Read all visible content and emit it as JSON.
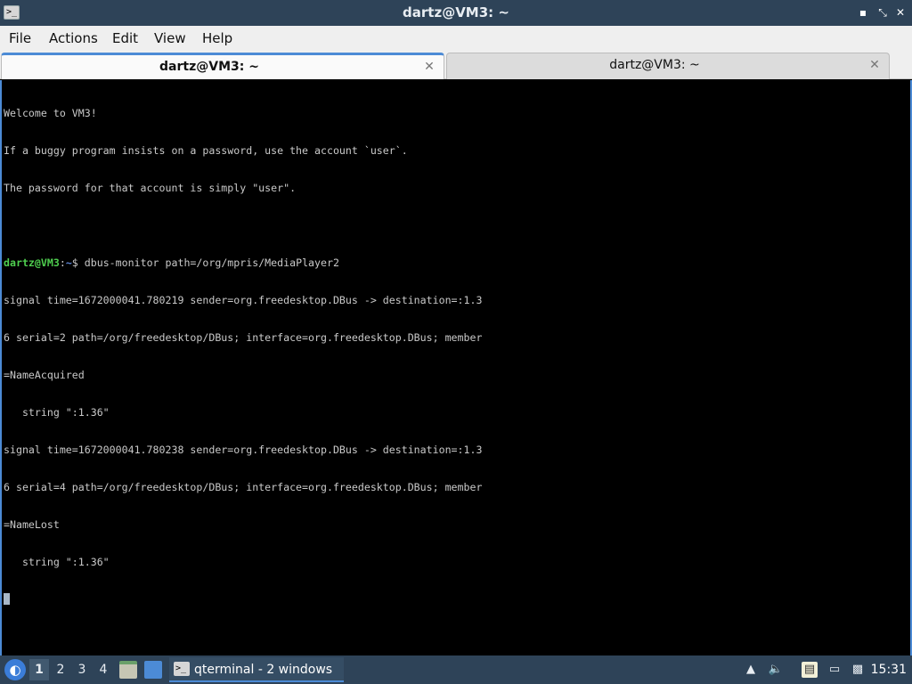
{
  "window": {
    "title": "dartz@VM3: ~",
    "app_icon_glyph": ">_"
  },
  "menu": {
    "items": [
      "File",
      "Actions",
      "Edit",
      "View",
      "Help"
    ]
  },
  "tabs": [
    {
      "label": "dartz@VM3: ~",
      "active": true
    },
    {
      "label": "dartz@VM3: ~",
      "active": false
    }
  ],
  "terminal": {
    "lines": [
      "Welcome to VM3!",
      "If a buggy program insists on a password, use the account `user`.",
      "The password for that account is simply \"user\".",
      "",
      "",
      "signal time=1672000041.780219 sender=org.freedesktop.DBus -> destination=:1.3",
      "6 serial=2 path=/org/freedesktop/DBus; interface=org.freedesktop.DBus; member",
      "=NameAcquired",
      "   string \":1.36\"",
      "signal time=1672000041.780238 sender=org.freedesktop.DBus -> destination=:1.3",
      "6 serial=4 path=/org/freedesktop/DBus; interface=org.freedesktop.DBus; member",
      "=NameLost",
      "   string \":1.36\""
    ],
    "prompt_user": "dartz@VM3",
    "prompt_sep": ":",
    "prompt_path": "~",
    "prompt_symbol": "$ ",
    "command": "dbus-monitor path=/org/mpris/MediaPlayer2"
  },
  "taskbar": {
    "desktops": [
      "1",
      "2",
      "3",
      "4"
    ],
    "active_desktop": "1",
    "task_label": "qterminal - 2 windows",
    "clock": "15:31",
    "colors": {
      "bar": "#2e4358",
      "accent": "#4c8bd6"
    }
  }
}
